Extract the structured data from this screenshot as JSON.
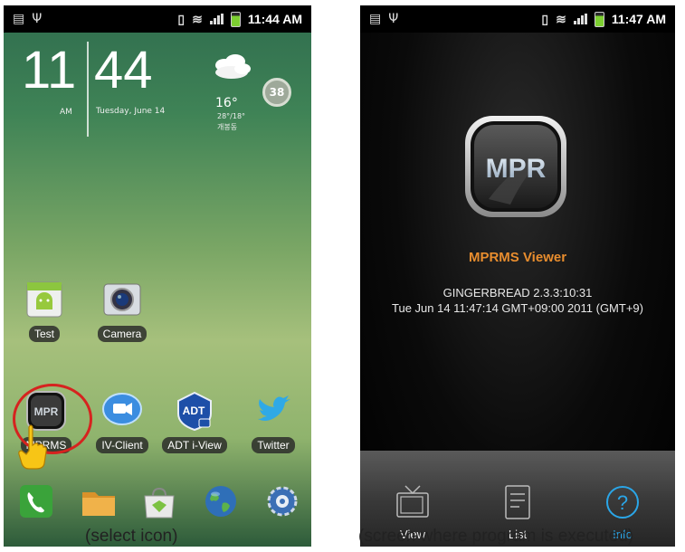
{
  "left_screen": {
    "status_time": "11:44 AM",
    "clock": {
      "hours": "11",
      "minutes": "44",
      "ampm": "AM",
      "date": "Tuesday, June 14"
    },
    "weather": {
      "temp": "16°",
      "range": "28°/18°",
      "location": "개봉동",
      "icon": "cloud-icon"
    },
    "badge": "38",
    "apps": [
      {
        "label": "Test",
        "icon": "android-app-icon"
      },
      {
        "label": "Camera",
        "icon": "camera-icon"
      },
      {
        "label": "MPRMS",
        "icon": "mpr-logo-icon"
      },
      {
        "label": "IV-Client",
        "icon": "video-chat-icon"
      },
      {
        "label": "ADT i-View",
        "icon": "adt-icon"
      },
      {
        "label": "Twitter",
        "icon": "twitter-bird-icon"
      }
    ],
    "dock": [
      "phone-icon",
      "folder-icon",
      "market-icon",
      "browser-globe-icon",
      "settings-gear-icon"
    ],
    "caption": "(select icon)"
  },
  "right_screen": {
    "status_time": "11:47 AM",
    "logo_text": "MPR",
    "title": "MPRMS Viewer",
    "info_line1": "GINGERBREAD 2.3.3:10:31",
    "info_line2": "Tue Jun 14 11:47:14 GMT+09:00 2011 (GMT+9)",
    "tabs": [
      {
        "label": "View",
        "icon": "tv-icon",
        "active": false
      },
      {
        "label": "List",
        "icon": "list-document-icon",
        "active": false
      },
      {
        "label": "Info",
        "icon": "help-circle-icon",
        "active": true
      }
    ],
    "caption": "(screen where program is executed)"
  },
  "colors": {
    "highlight": "#d6231f",
    "title_orange": "#e88d2e",
    "active_tab": "#2aa6e8"
  }
}
